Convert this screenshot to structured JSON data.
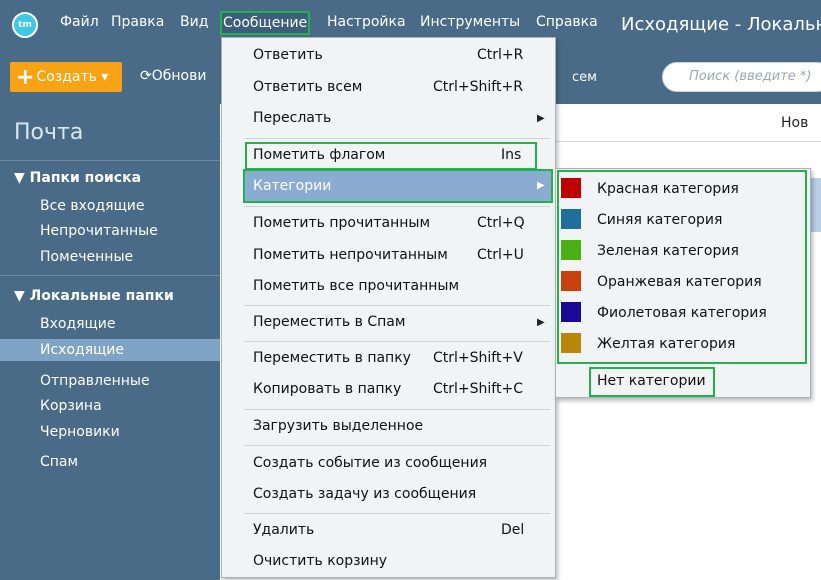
{
  "window_title": "Исходящие - Локальн",
  "app_logo": "tm",
  "menubar": {
    "items": [
      "Файл",
      "Правка",
      "Вид",
      "Сообщение",
      "Настройка",
      "Инструменты",
      "Справка"
    ]
  },
  "toolbar": {
    "create_label": "Создать",
    "refresh_label": "Обнови",
    "cut_text": "сем",
    "search_placeholder": "Поиск (введите *)"
  },
  "sidebar": {
    "title": "Почта",
    "search_folders_header": "Папки поиска",
    "search_folders": [
      "Все входящие",
      "Непрочитанные",
      "Помеченные"
    ],
    "local_folders_header": "Локальные папки",
    "local_folders": [
      "Входящие",
      "Исходящие",
      "Отправленные",
      "Корзина",
      "Черновики",
      "Спам"
    ],
    "selected": "Исходящие"
  },
  "content": {
    "header_cut": "Нов"
  },
  "message_menu": {
    "reply": "Ответить",
    "reply_shortcut": "Ctrl+R",
    "reply_all": "Ответить всем",
    "reply_all_shortcut": "Ctrl+Shift+R",
    "forward": "Переслать",
    "flag": "Пометить флагом",
    "flag_shortcut": "Ins",
    "categories": "Категории",
    "mark_read": "Пометить прочитанным",
    "mark_read_shortcut": "Ctrl+Q",
    "mark_unread": "Пометить непрочитанным",
    "mark_unread_shortcut": "Ctrl+U",
    "mark_all_read": "Пометить все прочитанным",
    "move_spam": "Переместить в Спам",
    "move_folder": "Переместить в папку",
    "move_folder_shortcut": "Ctrl+Shift+V",
    "copy_folder": "Копировать в папку",
    "copy_folder_shortcut": "Ctrl+Shift+C",
    "download_selected": "Загрузить выделенное",
    "create_event": "Создать событие из сообщения",
    "create_task": "Создать задачу из сообщения",
    "delete": "Удалить",
    "delete_shortcut": "Del",
    "empty_trash": "Очистить корзину"
  },
  "categories_submenu": {
    "items": [
      {
        "label": "Красная категория",
        "color": "#c00000"
      },
      {
        "label": "Синяя категория",
        "color": "#1f6f9a"
      },
      {
        "label": "Зеленая категория",
        "color": "#4caf18"
      },
      {
        "label": "Оранжевая категория",
        "color": "#c8410f"
      },
      {
        "label": "Фиолетовая категория",
        "color": "#1a0896"
      },
      {
        "label": "Желтая категория",
        "color": "#b8860b"
      }
    ],
    "none": "Нет категории"
  }
}
